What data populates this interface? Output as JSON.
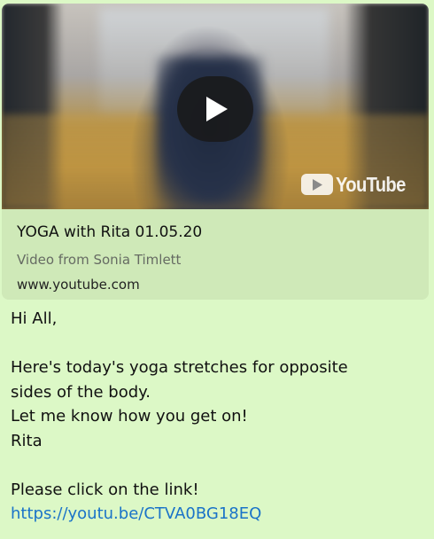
{
  "link_preview": {
    "thumbnail_icon": "youtube-video-thumbnail",
    "play_icon": "play-icon",
    "brand_text": "YouTube",
    "title": "YOGA with Rita 01.05.20",
    "subtitle": "Video from Sonia Timlett",
    "domain": "www.youtube.com"
  },
  "message": {
    "lines": [
      "Hi All,",
      "",
      "Here's today's yoga stretches for opposite",
      "sides of the body.",
      "Let me know how you get on!",
      "Rita",
      "",
      "Please click on the link!"
    ],
    "link": "https://youtu.be/CTVA0BG18EQ"
  },
  "colors": {
    "bubble_background": "#dcf8c6",
    "preview_background": "#cfe9b8",
    "link": "#1a73c8"
  }
}
